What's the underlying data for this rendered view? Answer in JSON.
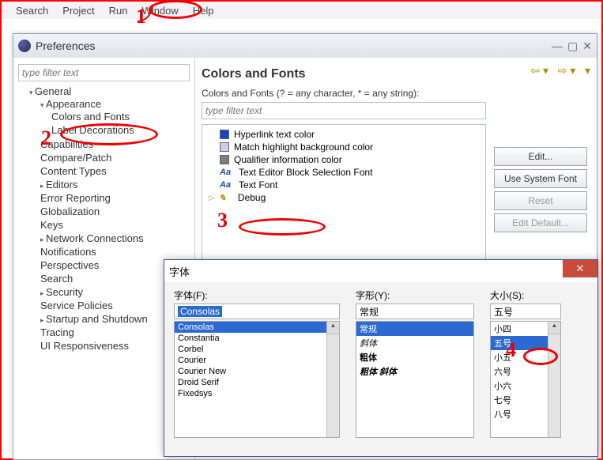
{
  "menubar": {
    "items": [
      "Search",
      "Project",
      "Run",
      "Window",
      "Help"
    ]
  },
  "pref": {
    "title": "Preferences"
  },
  "tree_filter_placeholder": "type filter text",
  "tree": {
    "general": "General",
    "appearance": "Appearance",
    "colors_and_fonts": "Colors and Fonts",
    "label_decorations": "Label Decorations",
    "capabilities": "Capabilities",
    "compare_patch": "Compare/Patch",
    "content_types": "Content Types",
    "editors": "Editors",
    "error_reporting": "Error Reporting",
    "globalization": "Globalization",
    "keys": "Keys",
    "network": "Network Connections",
    "notifications": "Notifications",
    "perspectives": "Perspectives",
    "search": "Search",
    "security": "Security",
    "service_policies": "Service Policies",
    "startup_shutdown": "Startup and Shutdown",
    "tracing": "Tracing",
    "ui_responsiveness": "UI Responsiveness"
  },
  "right": {
    "title": "Colors and Fonts",
    "desc": "Colors and Fonts (? = any character, * = any string):",
    "filter_placeholder": "type filter text"
  },
  "cf_items": {
    "hyperlink": "Hyperlink text color",
    "match": "Match highlight background color",
    "qualifier": "Qualifier information color",
    "block_font": "Text Editor Block Selection Font",
    "text_font": "Text Font",
    "debug": "Debug"
  },
  "cf_swatches": {
    "hyperlink": "#1346c4",
    "match": "#d5c9ec",
    "qualifier": "#7d7d7d"
  },
  "buttons": {
    "edit": "Edit...",
    "use_system_font": "Use System Font",
    "reset": "Reset",
    "edit_default": "Edit Default..."
  },
  "font_dialog": {
    "title": "字体",
    "font_label": "字体(F):",
    "style_label": "字形(Y):",
    "size_label": "大小(S):",
    "font_selected": "Consolas",
    "style_selected": "常规",
    "size_selected": "五号",
    "fonts": [
      "Consolas",
      "Constantia",
      "Corbel",
      "Courier",
      "Courier New",
      "Droid Serif",
      "Fixedsys"
    ],
    "styles": [
      "常规",
      "斜体",
      "粗体",
      "粗体 斜体"
    ],
    "sizes": [
      "小四",
      "五号",
      "小五",
      "六号",
      "小六",
      "七号",
      "八号"
    ]
  },
  "annotations": {
    "n1": "1",
    "n2": "2",
    "n3": "3",
    "n4": "4"
  }
}
